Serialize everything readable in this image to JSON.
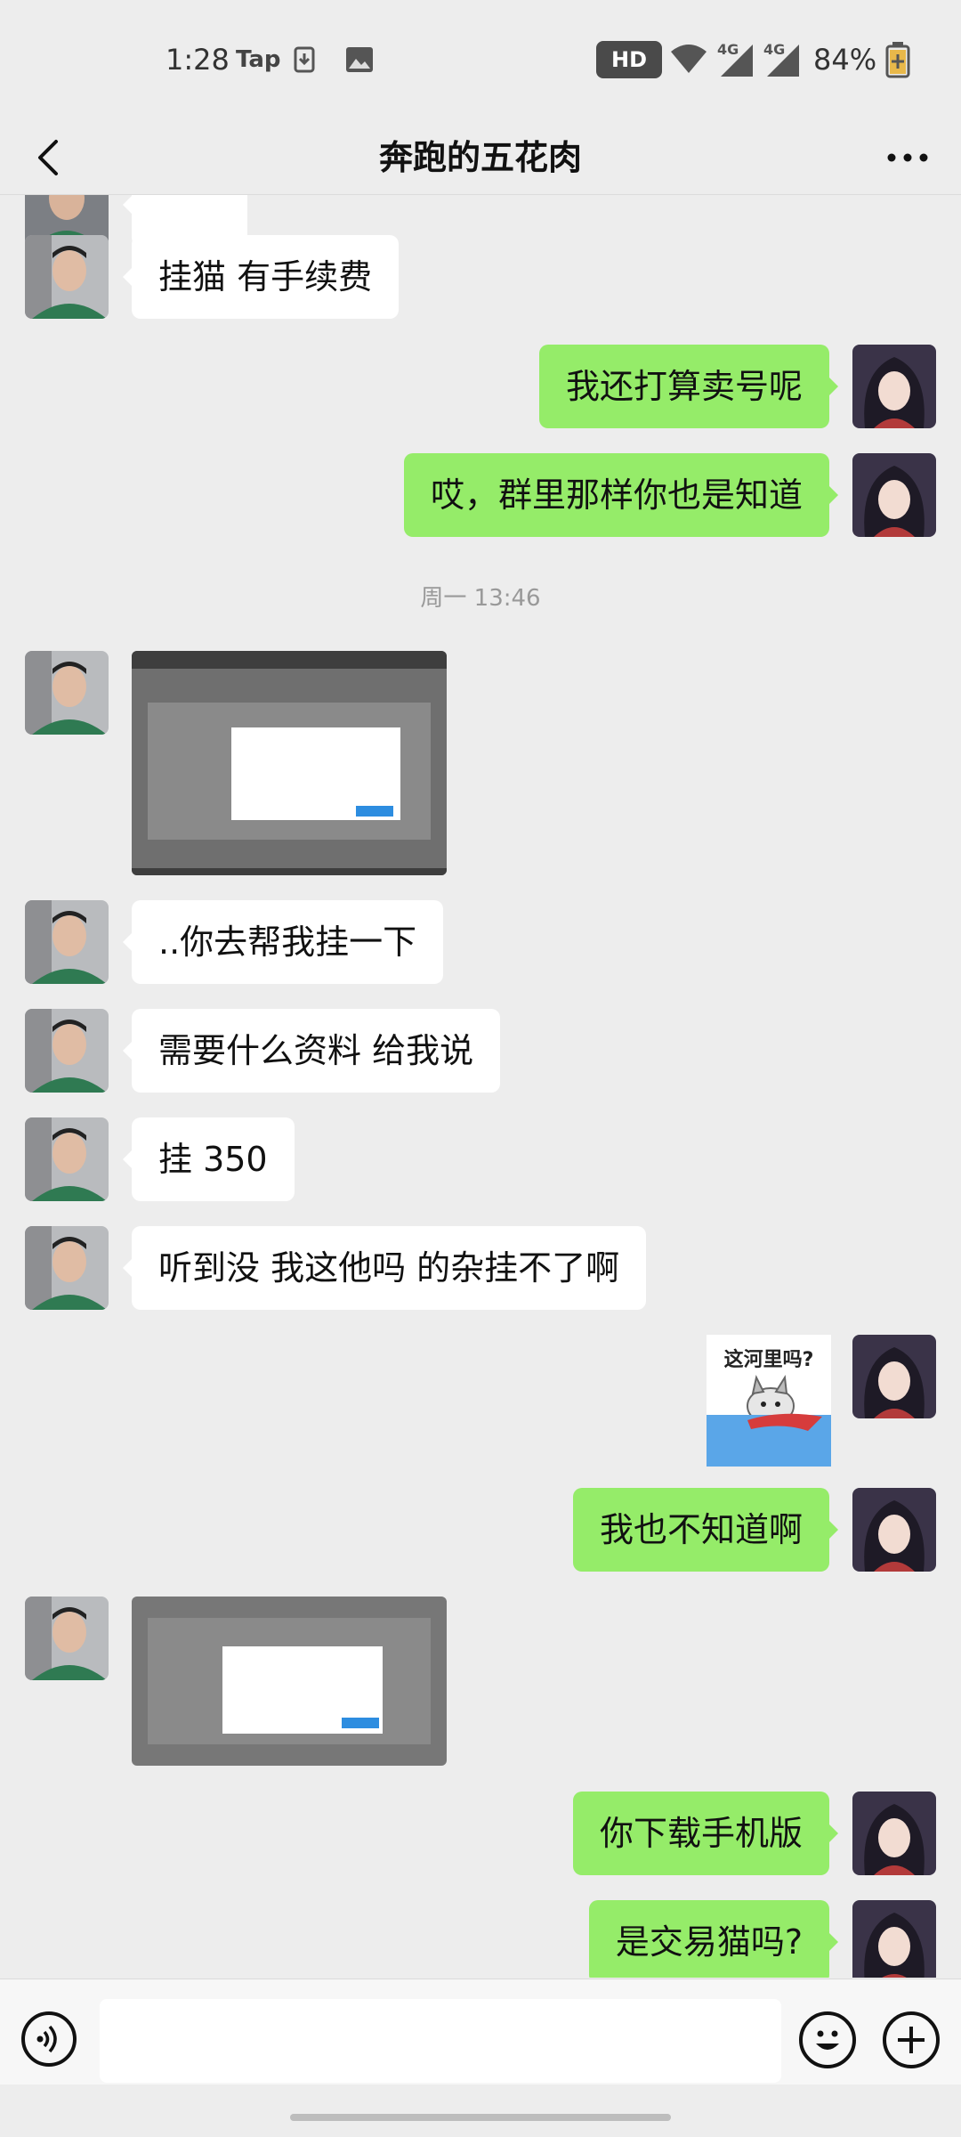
{
  "status_bar": {
    "time": "1:28",
    "app_label": "Tap",
    "hd_label": "HD",
    "network_1": "4G",
    "network_2": "4G",
    "battery": "84%"
  },
  "header": {
    "title": "奔跑的五花肉"
  },
  "messages": [
    {
      "side": "left",
      "type": "text",
      "text": "挂猫 有手续费"
    },
    {
      "side": "right",
      "type": "text",
      "text": "我还打算卖号呢"
    },
    {
      "side": "right",
      "type": "text",
      "text": "哎，群里那样你也是知道"
    },
    {
      "type": "timestamp",
      "text": "周一 13:46"
    },
    {
      "side": "left",
      "type": "image",
      "description": "screenshot"
    },
    {
      "side": "left",
      "type": "text",
      "text": "..你去帮我挂一下"
    },
    {
      "side": "left",
      "type": "text",
      "text": "需要什么资料 给我说"
    },
    {
      "side": "left",
      "type": "text",
      "text": "挂 350"
    },
    {
      "side": "left",
      "type": "text",
      "text": "听到没 我这他吗 的杂挂不了啊"
    },
    {
      "side": "right",
      "type": "sticker",
      "caption": "这河里吗?"
    },
    {
      "side": "right",
      "type": "text",
      "text": "我也不知道啊"
    },
    {
      "side": "left",
      "type": "image",
      "description": "screenshot"
    },
    {
      "side": "right",
      "type": "text",
      "text": "你下载手机版"
    },
    {
      "side": "right",
      "type": "text",
      "text": "是交易猫吗?"
    }
  ],
  "input_bar": {
    "placeholder": "",
    "icons": [
      "voice-icon",
      "emoji-icon",
      "plus-icon"
    ]
  },
  "colors": {
    "background": "#EDEDED",
    "self_bubble": "#95EC69",
    "other_bubble": "#FFFFFF"
  }
}
